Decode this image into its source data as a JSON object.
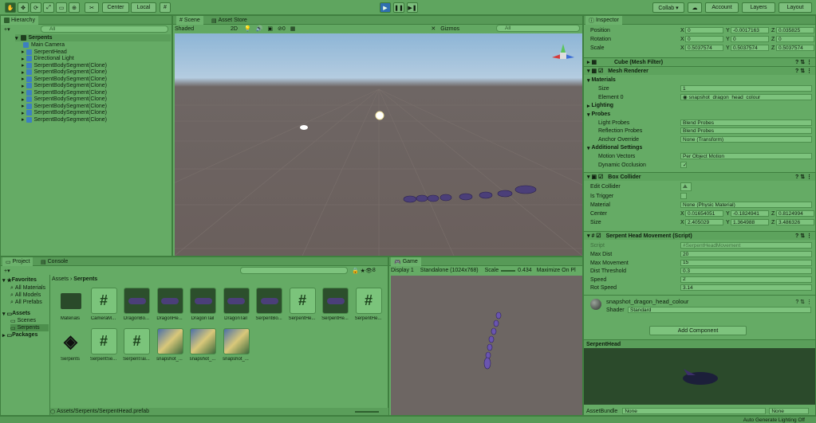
{
  "toolbar": {
    "center": "Center",
    "local": "Local",
    "collab": "Collab ▾",
    "account": "Account",
    "layers": "Layers",
    "layout": "Layout"
  },
  "hierarchy": {
    "tab": "Hierarchy",
    "search": "All",
    "scene": "Serpents",
    "items": [
      "Main Camera",
      "SerpentHead",
      "Directional Light",
      "SerpentBodySegment(Clone)",
      "SerpentBodySegment(Clone)",
      "SerpentBodySegment(Clone)",
      "SerpentBodySegment(Clone)",
      "SerpentBodySegment(Clone)",
      "SerpentBodySegment(Clone)",
      "SerpentBodySegment(Clone)",
      "SerpentBodySegment(Clone)",
      "SerpentBodySegment(Clone)"
    ]
  },
  "scene": {
    "tab1": "Scene",
    "tab2": "Asset Store",
    "shading": "Shaded",
    "twod": "2D",
    "gizmos": "Gizmos",
    "search": "All",
    "hidden": "0"
  },
  "project": {
    "tab1": "Project",
    "tab2": "Console",
    "count": "8",
    "breadcrumb_root": "Assets",
    "breadcrumb_leaf": "Serpents",
    "footer": "Assets/Serpents/SerpentHead.prefab",
    "favorites": "Favorites",
    "fav_items": [
      "All Materials",
      "All Models",
      "All Prefabs"
    ],
    "assets": "Assets",
    "asset_items": [
      "Scenes",
      "Serpents"
    ],
    "packages": "Packages",
    "row1": [
      "Materials",
      "CameraM...",
      "DragonBo...",
      "DragonHe...",
      "DragonTail",
      "DragonTail",
      "SerpentBo...",
      "SerpentHe...",
      "SerpentHe...",
      "SerpentHe..."
    ],
    "row2": [
      "Serpents",
      "SerpentSe...",
      "SerpentTai...",
      "snapshot_...",
      "snapshot_...",
      "snapshot_..."
    ]
  },
  "game": {
    "tab": "Game",
    "display": "Display 1",
    "res": "Standalone (1024x768)",
    "scale_label": "Scale",
    "scale": "0.434",
    "maximize": "Maximize On Pl"
  },
  "inspector": {
    "tab": "Inspector",
    "transform": [
      {
        "label": "Position",
        "x": "0",
        "y": "-0.0017163",
        "z": "0.035825"
      },
      {
        "label": "Rotation",
        "x": "0",
        "y": "0",
        "z": "0"
      },
      {
        "label": "Scale",
        "x": "0.5037574",
        "y": "0.5037574",
        "z": "0.5037574"
      }
    ],
    "mesh_filter": "Cube (Mesh Filter)",
    "mesh_renderer": "Mesh Renderer",
    "materials": "Materials",
    "size_label": "Size",
    "size": "1",
    "element0_label": "Element 0",
    "element0": "snapshot_dragon_head_colour",
    "lighting": "Lighting",
    "probes": "Probes",
    "light_probes_label": "Light Probes",
    "light_probes": "Blend Probes",
    "reflection_probes_label": "Reflection Probes",
    "reflection_probes": "Blend Probes",
    "anchor_label": "Anchor Override",
    "anchor": "None (Transform)",
    "additional": "Additional Settings",
    "motion_label": "Motion Vectors",
    "motion": "Per Object Motion",
    "occlusion_label": "Dynamic Occlusion",
    "box_collider": "Box Collider",
    "edit_collider": "Edit Collider",
    "is_trigger": "Is Trigger",
    "material_label": "Material",
    "material": "None (Physic Material)",
    "center_label": "Center",
    "center": {
      "x": "0.01654051",
      "y": "-0.1824941",
      "z": "0.8124994"
    },
    "csize_label": "Size",
    "csize": {
      "x": "2.405029",
      "y": "1.364988",
      "z": "3.486326"
    },
    "script_comp": "Serpent Head Movement (Script)",
    "script_label": "Script",
    "script": "SerpentHeadMovement",
    "params": [
      {
        "label": "Max Dist",
        "value": "20"
      },
      {
        "label": "Max Movement",
        "value": "15"
      },
      {
        "label": "Dist Threshold",
        "value": "0.3"
      },
      {
        "label": "Speed",
        "value": "2"
      },
      {
        "label": "Rot Speed",
        "value": "3.14"
      }
    ],
    "material_name": "snapshot_dragon_head_colour",
    "shader_label": "Shader",
    "shader": "Standard",
    "add_component": "Add Component",
    "preview_title": "SerpentHead",
    "assetbundle_label": "AssetBundle",
    "assetbundle": "None",
    "assetbundle2": "None"
  },
  "status": "Auto Generate Lighting Off"
}
